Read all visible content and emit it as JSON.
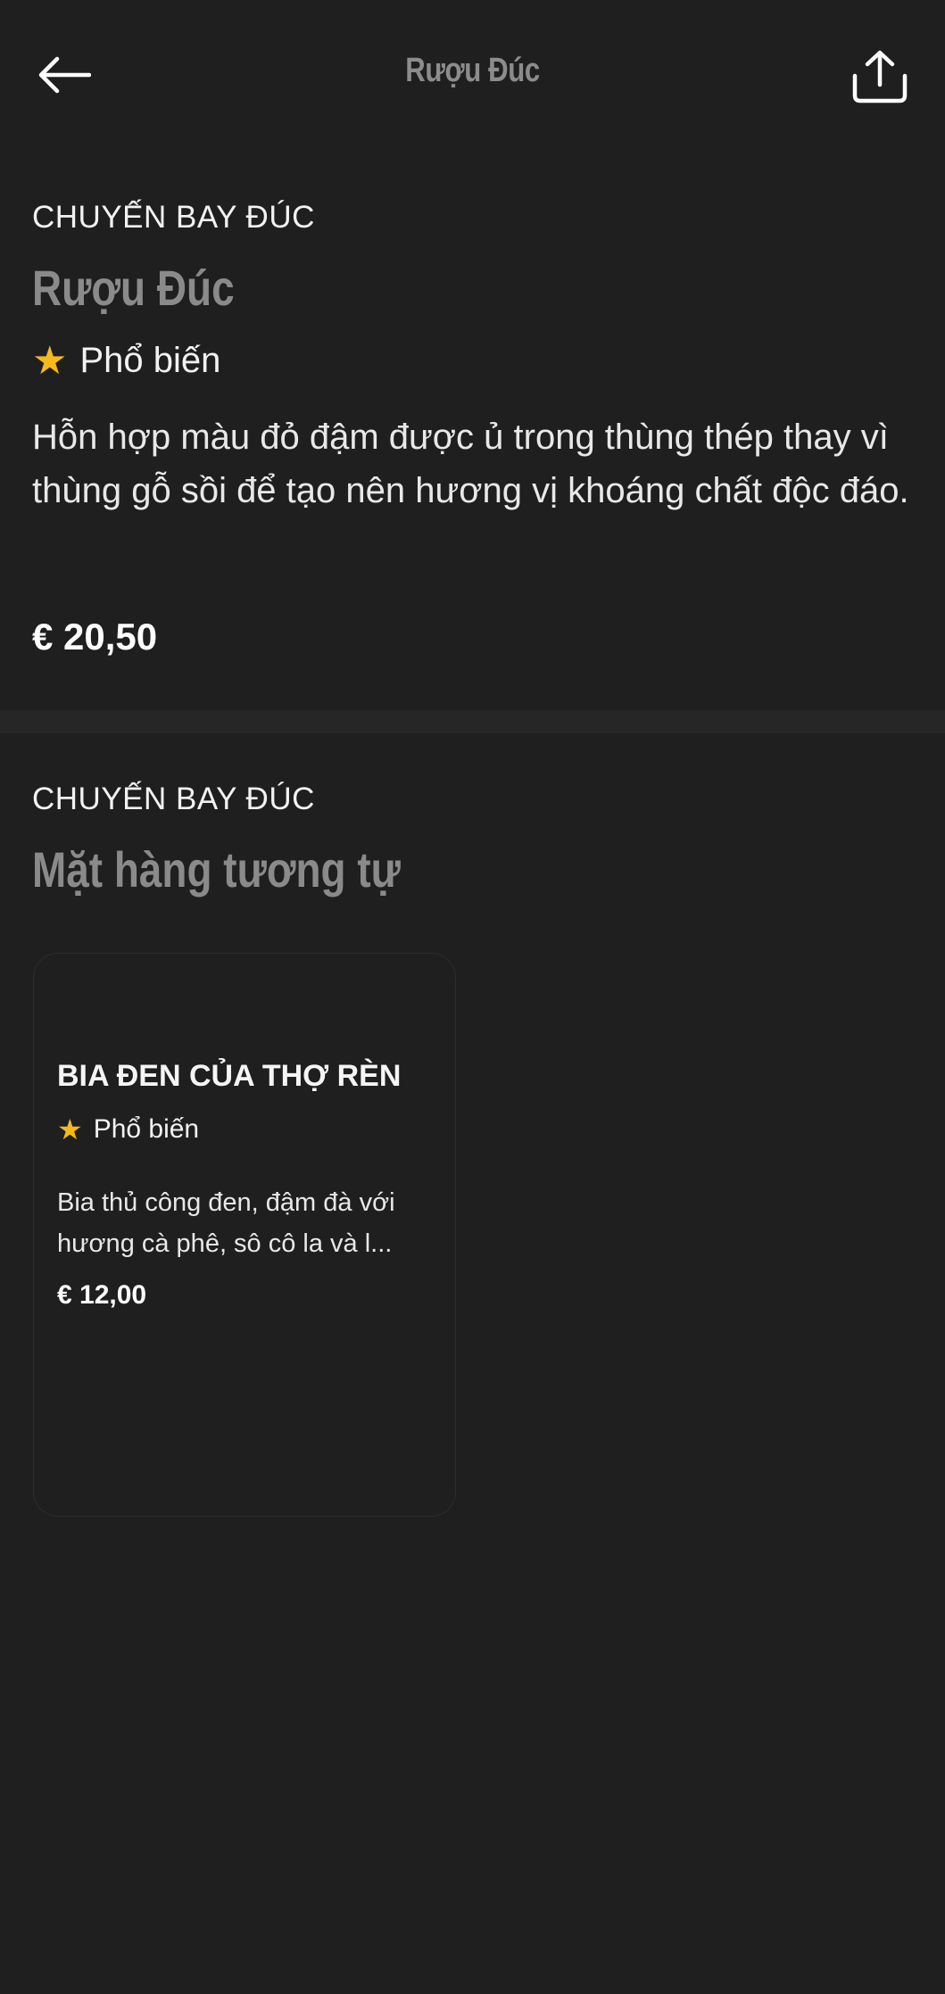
{
  "header": {
    "title": "Rượu Đúc",
    "back_icon": "arrow-left-icon",
    "share_icon": "share-icon"
  },
  "product": {
    "category": "CHUYẾN BAY ĐÚC",
    "name": "Rượu Đúc",
    "rating_label": "Phổ biến",
    "description": "Hỗn hợp màu đỏ đậm được ủ trong thùng thép thay vì thùng gỗ sồi để tạo nên hương vị khoáng chất độc đáo.",
    "price": "€ 20,50"
  },
  "similar": {
    "category": "CHUYẾN BAY ĐÚC",
    "heading": "Mặt hàng tương tự",
    "items": [
      {
        "name": "BIA ĐEN CỦA THỢ RÈN",
        "rating_label": "Phổ biến",
        "description_line1": "Bia thủ công đen, đậm đà với",
        "description_line2": "hương cà phê, sô cô la và l...",
        "price": "€ 12,00"
      }
    ]
  },
  "colors": {
    "background": "#1f1f1f",
    "divider": "#262626",
    "star": "#f6b91b",
    "muted_title": "#8a8a8a"
  }
}
